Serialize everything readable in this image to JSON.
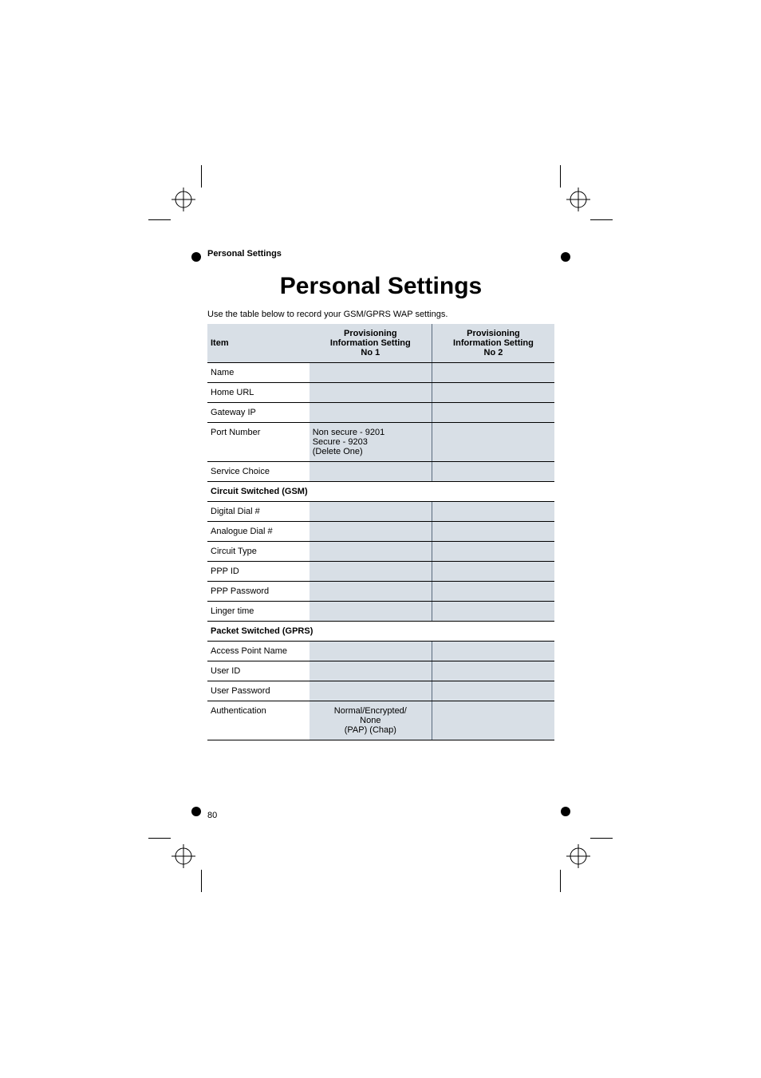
{
  "header_label": "Personal Settings",
  "title": "Personal Settings",
  "intro": "Use the table below to record your GSM/GPRS WAP settings.",
  "columns": {
    "item": "Item",
    "col1_line1": "Provisioning",
    "col1_line2": "Information Setting",
    "col1_line3": "No 1",
    "col2_line1": "Provisioning",
    "col2_line2": "Information Setting",
    "col2_line3": "No 2"
  },
  "rows": {
    "name": "Name",
    "home_url": "Home URL",
    "gateway_ip": "Gateway IP",
    "port_number": "Port Number",
    "port_number_val_l1": "Non secure - 9201",
    "port_number_val_l2": "Secure - 9203",
    "port_number_val_l3": "(Delete One)",
    "service_choice": "Service Choice",
    "section_gsm": "Circuit Switched (GSM)",
    "digital_dial": "Digital Dial #",
    "analogue_dial": "Analogue Dial #",
    "circuit_type": "Circuit Type",
    "ppp_id": "PPP ID",
    "ppp_password": "PPP Password",
    "linger_time": "Linger time",
    "section_gprs": "Packet Switched (GPRS)",
    "access_point": "Access Point Name",
    "user_id": "User ID",
    "user_password": "User Password",
    "authentication": "Authentication",
    "auth_val_l1": "Normal/Encrypted/",
    "auth_val_l2": "None",
    "auth_val_l3": "(PAP)   (Chap)"
  },
  "page_number": "80"
}
